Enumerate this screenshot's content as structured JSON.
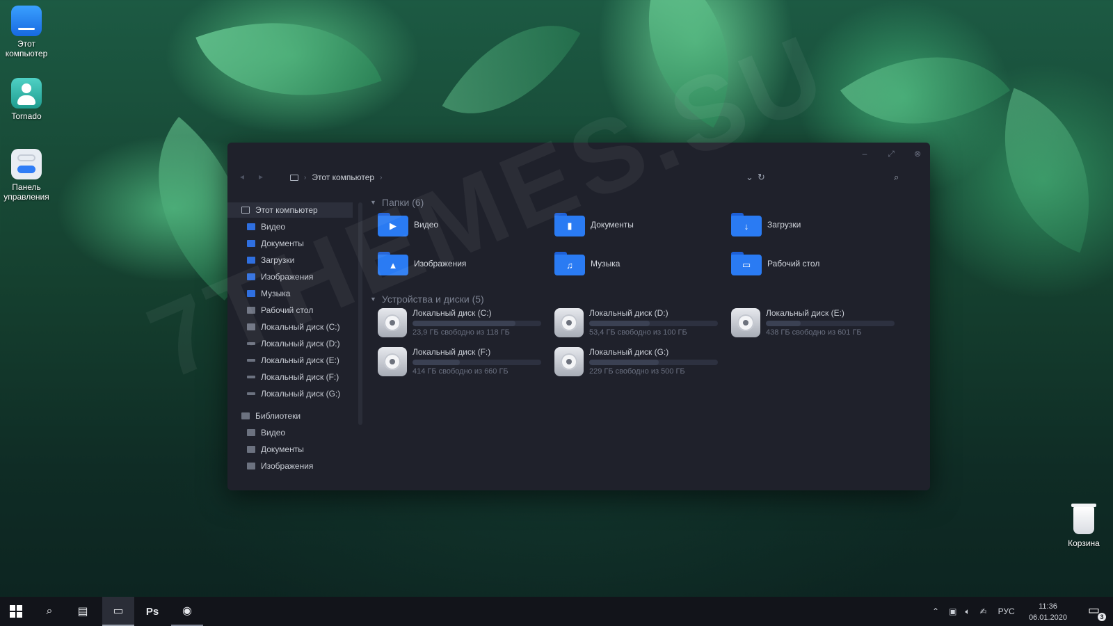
{
  "desktop": {
    "icons": [
      {
        "label_line1": "Этот",
        "label_line2": "компьютер",
        "icon": "computer-icon"
      },
      {
        "label_line1": "Tornado",
        "label_line2": "",
        "icon": "user-icon"
      },
      {
        "label_line1": "Панель",
        "label_line2": "управления",
        "icon": "control-panel-icon"
      }
    ],
    "recycle_bin": {
      "label": "Корзина",
      "icon": "recycle-bin-icon"
    },
    "watermark": "7THEMES.SU"
  },
  "window": {
    "breadcrumb": {
      "root_label": "Этот компьютер"
    },
    "sidebar": {
      "items": [
        {
          "label": "Этот компьютер",
          "icon": "computer-icon"
        },
        {
          "label": "Видео",
          "icon": "video-folder-icon"
        },
        {
          "label": "Документы",
          "icon": "documents-folder-icon"
        },
        {
          "label": "Загрузки",
          "icon": "downloads-folder-icon"
        },
        {
          "label": "Изображения",
          "icon": "pictures-folder-icon"
        },
        {
          "label": "Музыка",
          "icon": "music-folder-icon"
        },
        {
          "label": "Рабочий стол",
          "icon": "desktop-folder-icon"
        },
        {
          "label": "Локальный диск (C:)",
          "icon": "drive-icon"
        },
        {
          "label": "Локальный диск (D:)",
          "icon": "drive-icon"
        },
        {
          "label": "Локальный диск (E:)",
          "icon": "drive-icon"
        },
        {
          "label": "Локальный диск (F:)",
          "icon": "drive-icon"
        },
        {
          "label": "Локальный диск (G:)",
          "icon": "drive-icon"
        },
        {
          "label": "Библиотеки",
          "icon": "libraries-icon"
        },
        {
          "label": "Видео",
          "icon": "video-library-icon"
        },
        {
          "label": "Документы",
          "icon": "documents-library-icon"
        },
        {
          "label": "Изображения",
          "icon": "pictures-library-icon"
        }
      ]
    },
    "folders_group": {
      "title": "Папки (6)",
      "items": [
        {
          "label": "Видео",
          "glyph": "▶"
        },
        {
          "label": "Документы",
          "glyph": "▮"
        },
        {
          "label": "Загрузки",
          "glyph": "↓"
        },
        {
          "label": "Изображения",
          "glyph": "▲"
        },
        {
          "label": "Музыка",
          "glyph": "♫"
        },
        {
          "label": "Рабочий стол",
          "glyph": "▭"
        }
      ]
    },
    "drives_group": {
      "title": "Устройства и диски (5)",
      "items": [
        {
          "label": "Локальный диск (C:)",
          "free": "23,9 ГБ свободно из 118 ГБ",
          "used_fraction": 0.8
        },
        {
          "label": "Локальный диск (D:)",
          "free": "53,4 ГБ свободно из 100 ГБ",
          "used_fraction": 0.47
        },
        {
          "label": "Локальный диск (E:)",
          "free": "438 ГБ свободно из 601 ГБ",
          "used_fraction": 0.27
        },
        {
          "label": "Локальный диск (F:)",
          "free": "414 ГБ свободно из 660 ГБ",
          "used_fraction": 0.37
        },
        {
          "label": "Локальный диск (G:)",
          "free": "229 ГБ свободно из 500 ГБ",
          "used_fraction": 0.54
        }
      ]
    }
  },
  "taskbar": {
    "ps_label": "Ps",
    "language": "РУС",
    "time": "11:36",
    "date": "06.01.2020",
    "notification_count": "3"
  }
}
